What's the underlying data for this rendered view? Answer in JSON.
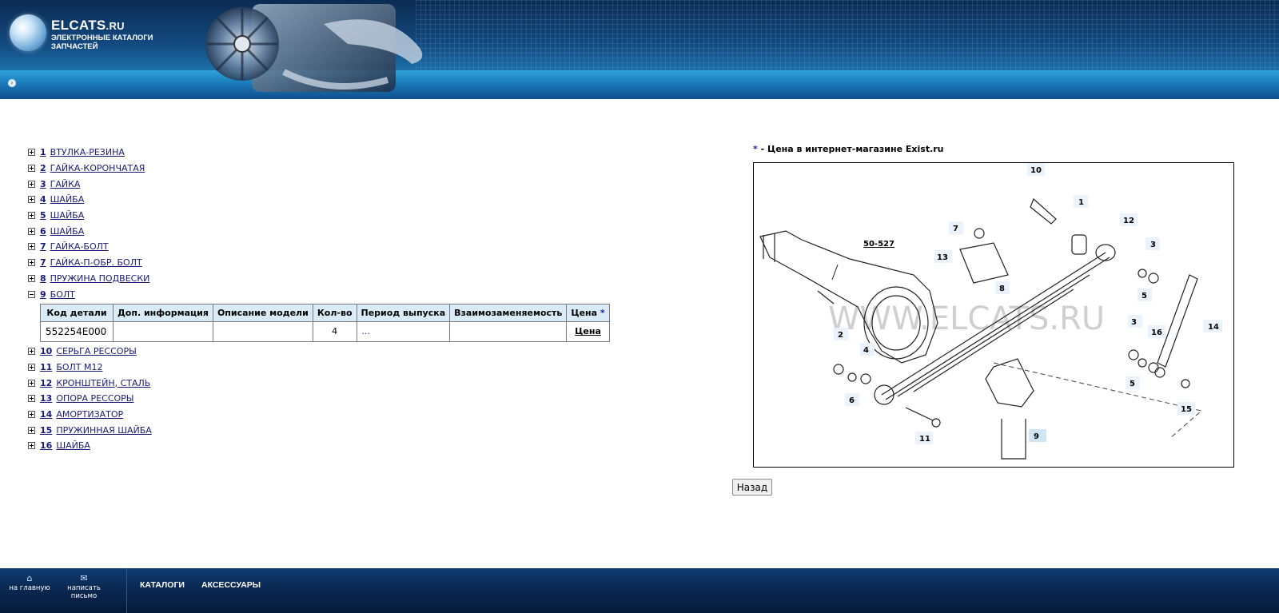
{
  "header": {
    "brand_main": "ELCATS",
    "brand_suffix": ".RU",
    "brand_sub_1": "ЭЛЕКТРОННЫЕ КАТАЛОГИ",
    "brand_sub_2": "ЗАПЧАСТЕЙ"
  },
  "parts": [
    {
      "num": "1",
      "name": "ВТУЛКА-РЕЗИНА"
    },
    {
      "num": "2",
      "name": "ГАЙКА-КОРОНЧАТАЯ"
    },
    {
      "num": "3",
      "name": "ГАЙКА"
    },
    {
      "num": "4",
      "name": "ШАЙБА"
    },
    {
      "num": "5",
      "name": "ШАЙБА"
    },
    {
      "num": "6",
      "name": "ШАЙБА"
    },
    {
      "num": "7",
      "name": "ГАЙКА-БОЛТ"
    },
    {
      "num": "7",
      "name": "ГАЙКА-П-ОБР. БОЛТ"
    },
    {
      "num": "8",
      "name": "ПРУЖИНА ПОДВЕСКИ"
    },
    {
      "num": "9",
      "name": "БОЛТ"
    },
    {
      "num": "10",
      "name": "СЕРЬГА РЕССОРЫ"
    },
    {
      "num": "11",
      "name": "БОЛТ M12"
    },
    {
      "num": "12",
      "name": "КРОНШТЕЙН, СТАЛЬ"
    },
    {
      "num": "13",
      "name": "ОПОРА РЕССОРЫ"
    },
    {
      "num": "14",
      "name": "АМОРТИЗАТОР"
    },
    {
      "num": "15",
      "name": "ПРУЖИННАЯ ШАЙБА"
    },
    {
      "num": "16",
      "name": "ШАЙБА"
    }
  ],
  "table": {
    "headers": [
      "Код детали",
      "Доп. информация",
      "Описание модели",
      "Кол-во",
      "Период выпуска",
      "Взаимозаменяемость",
      "Цена"
    ],
    "price_star": "*",
    "row": {
      "code": "552254E000",
      "extra": "",
      "model": "",
      "qty": "4",
      "period": "...",
      "interchange": "",
      "price": "Цена"
    }
  },
  "price_note": {
    "star": "*",
    "text": " - Цена в интернет-магазине Exist.ru"
  },
  "diagram": {
    "watermark": "WWW.ELCATS.RU",
    "ref_label": "50-527",
    "callouts": [
      "10",
      "1",
      "12",
      "3",
      "7",
      "13",
      "8",
      "5",
      "2",
      "4",
      "3",
      "16",
      "14",
      "6",
      "5",
      "15",
      "11",
      "9"
    ]
  },
  "back_button": "Назад",
  "footer": {
    "home": "на главную",
    "mail": "написать письмо",
    "catalogs": "КАТАЛОГИ",
    "accessories": "АКСЕССУАРЫ"
  },
  "colors": {
    "header_dark": "#0b2b52",
    "header_band": "#2fa3da",
    "link": "#1a1a7a",
    "table_header_bg": "#d9ebf7",
    "footer": "#0a2a55"
  }
}
